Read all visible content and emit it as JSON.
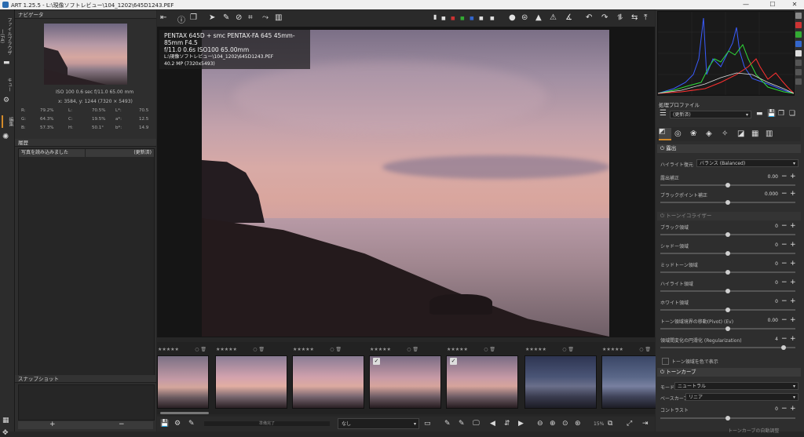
{
  "window": {
    "title": "ART 1.25.5 - L:\\現像ソフトレビュー\\104_1202\\645D1243.PEF",
    "minimize": "—",
    "maximize": "☐",
    "close": "✕"
  },
  "left_tabs": {
    "file_browser": "ファイルブラウザー(F4)",
    "queue": "キュー",
    "edit": "編集"
  },
  "navigator": {
    "header": "ナビゲータ",
    "exif_line": "ISO 100  0.6 sec  f/11.0  65.00 mm",
    "coords": "x: 3584, y: 1244  (7320 × 5493)",
    "readout": [
      {
        "k1": "R:",
        "v1": "79.2%",
        "k2": "L:",
        "v2": "70.5%",
        "k3": "L*:",
        "v3": "70.5"
      },
      {
        "k1": "G:",
        "v1": "64.3%",
        "k2": "C:",
        "v2": "19.5%",
        "k3": "a*:",
        "v3": "12.5"
      },
      {
        "k1": "B:",
        "v1": "57.3%",
        "k2": "H:",
        "v2": "50.1°",
        "k3": "b*:",
        "v3": "14.9"
      }
    ]
  },
  "history": {
    "header": "履歴",
    "rows": [
      {
        "label": "写真を読み込みました",
        "value": "(更新済)"
      }
    ]
  },
  "snapshots": {
    "header": "スナップショット",
    "add": "+",
    "remove": "−"
  },
  "exif_overlay": {
    "camera": "PENTAX 645D + smc PENTAX-FA 645 45mm-85mm F4.5",
    "exposure": "f/11.0  0.6s  ISO100  65.00mm",
    "path": "L:\\現像ソフトレビュー\\104_1202\\645D1243.PEF",
    "megapixels": "40.2 MP (7320x5493)"
  },
  "filmstrip": {
    "stars": "★★★★★",
    "thumbs": [
      {
        "checked": false,
        "selected": false
      },
      {
        "checked": false,
        "selected": false
      },
      {
        "checked": false,
        "selected": false
      },
      {
        "checked": true,
        "selected": false
      },
      {
        "checked": true,
        "selected": true
      },
      {
        "checked": false,
        "selected": false
      },
      {
        "checked": false,
        "selected": false
      }
    ]
  },
  "bottom": {
    "status": "準備完了",
    "profile_select": "なし",
    "zoom": "15%"
  },
  "right": {
    "processing_profile_header": "処理プロファイル",
    "profile_value": "(更新済)",
    "exposure_header": "露出",
    "highlight_label": "ハイライト復元",
    "highlight_value": "バランス (Balanced)",
    "exposure_comp_label": "露出補正",
    "exposure_comp_value": "0.00",
    "black_point_label": "ブラックポイント補正",
    "black_point_value": "0.000",
    "tone_eq_header": "トーンイコライザー",
    "tone_sliders": [
      {
        "label": "ブラック領域",
        "value": "0"
      },
      {
        "label": "シャドー領域",
        "value": "0"
      },
      {
        "label": "ミッドトーン領域",
        "value": "0"
      },
      {
        "label": "ハイライト領域",
        "value": "0"
      },
      {
        "label": "ホワイト領域",
        "value": "0"
      },
      {
        "label": "トーン領域境界の移動(Pivot) (Ev)",
        "value": "0.00"
      },
      {
        "label": "領域間変化の円滑化 (Regularization)",
        "value": "4"
      }
    ],
    "show_colors_label": "トーン領域を色で表示",
    "tone_curve_header": "トーンカーブ",
    "mode_label": "モード:",
    "mode_value": "ニュートラル",
    "base_curve_label": "ベースカーブ:",
    "base_curve_value": "リニア",
    "contrast_label": "コントラスト",
    "contrast_value": "0",
    "next_label": "トーンカーブの自動調整"
  },
  "colors": {
    "accent": "#d38a2a",
    "panel": "#2e2e2e"
  }
}
